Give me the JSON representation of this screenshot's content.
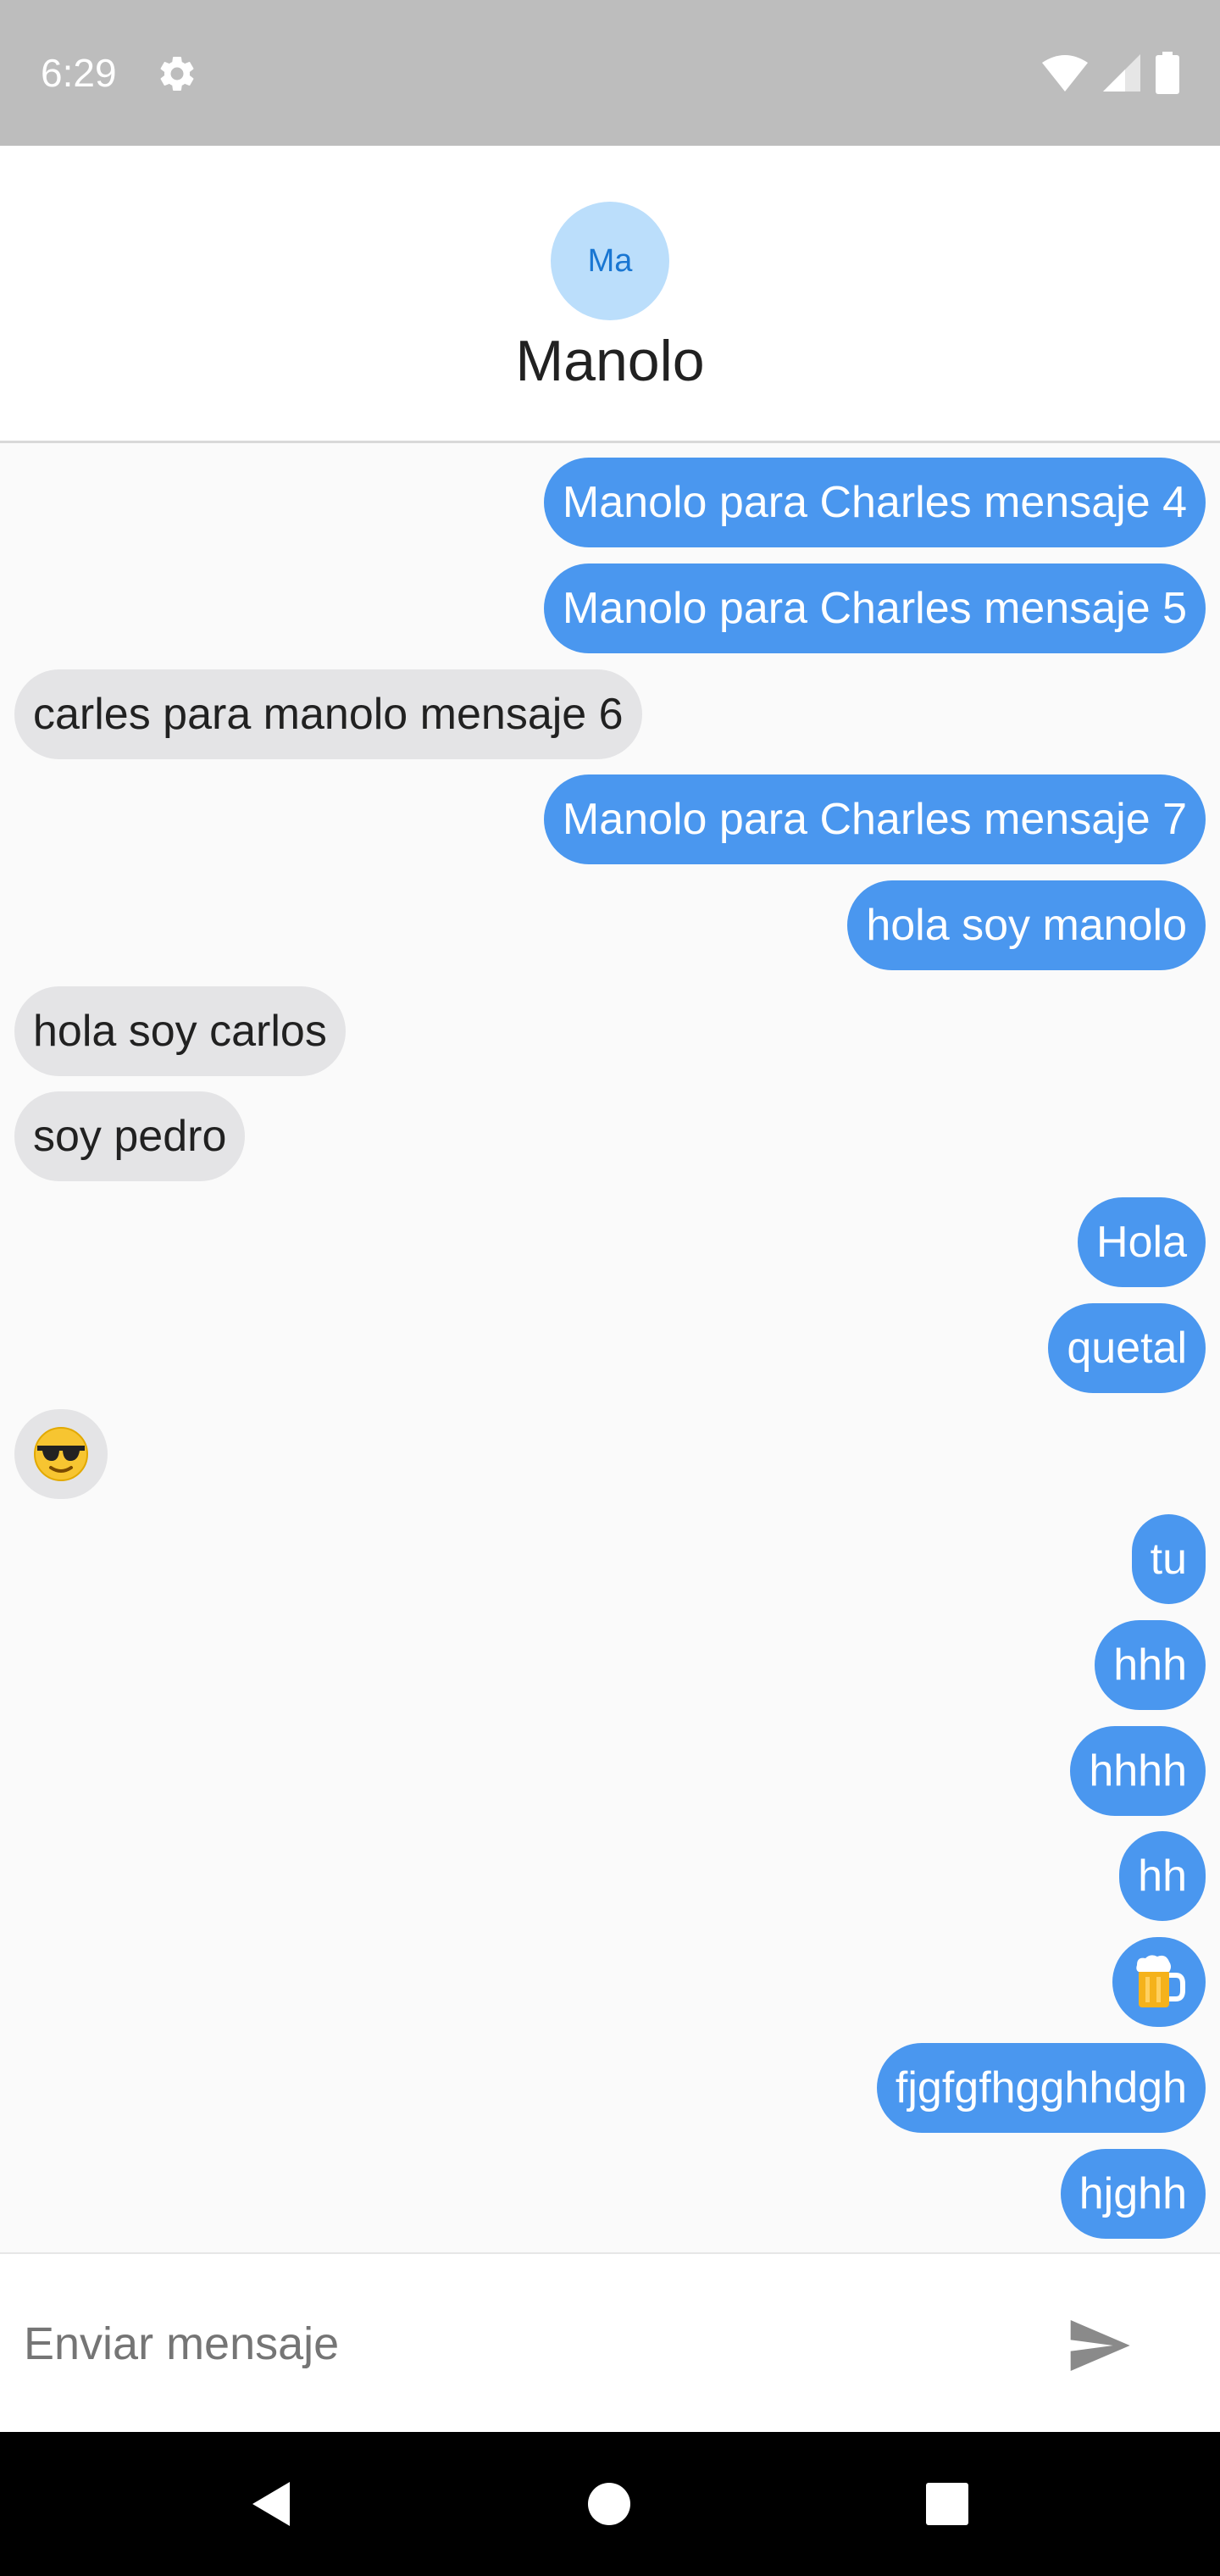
{
  "status": {
    "time": "6:29",
    "icons": [
      "gear-icon",
      "wifi-icon",
      "signal-icon",
      "battery-icon"
    ]
  },
  "header": {
    "avatar_initials": "Ma",
    "title": "Manolo"
  },
  "messages": [
    {
      "dir": "out",
      "text": "Manolo para Charles mensaje 4"
    },
    {
      "dir": "out",
      "text": "Manolo para Charles mensaje 5"
    },
    {
      "dir": "in",
      "text": "carles para manolo mensaje 6"
    },
    {
      "dir": "out",
      "text": "Manolo para Charles mensaje 7"
    },
    {
      "dir": "out",
      "text": "hola soy manolo"
    },
    {
      "dir": "in",
      "text": "hola soy carlos"
    },
    {
      "dir": "in",
      "text": "soy pedro"
    },
    {
      "dir": "out",
      "text": "Hola"
    },
    {
      "dir": "out",
      "text": "quetal"
    },
    {
      "dir": "in",
      "text": "😎"
    },
    {
      "dir": "out",
      "text": "tu"
    },
    {
      "dir": "out",
      "text": "hhh"
    },
    {
      "dir": "out",
      "text": "hhhh"
    },
    {
      "dir": "out",
      "text": "hh"
    },
    {
      "dir": "out",
      "text": "🍺"
    },
    {
      "dir": "out",
      "text": "fjgfgfhgghhdgh"
    },
    {
      "dir": "out",
      "text": "hjghh"
    }
  ],
  "composer": {
    "placeholder": "Enviar mensaje",
    "send_icon": "send-icon"
  },
  "navigation": {
    "icons": [
      "back-icon",
      "home-icon",
      "recents-icon"
    ]
  },
  "colors": {
    "outgoing_bubble": "#4a97ef",
    "incoming_bubble": "#e4e4e6",
    "avatar_background": "#bbdefb",
    "avatar_text": "#1976d2"
  }
}
